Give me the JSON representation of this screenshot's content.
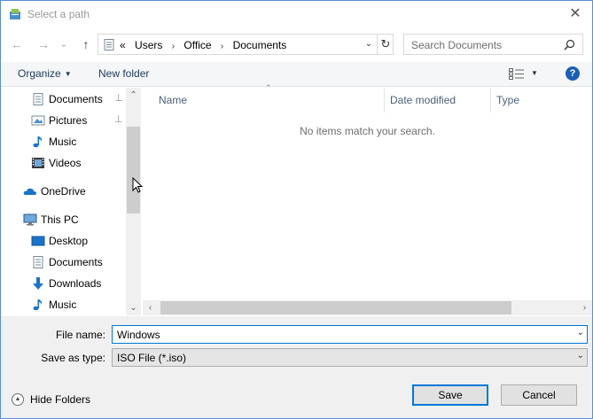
{
  "window": {
    "title": "Select a path",
    "close": "✕"
  },
  "nav": {
    "back": "←",
    "forward": "→",
    "recent": "⌄",
    "up": "↑",
    "crumb_prefix": "«",
    "path": [
      "Users",
      "Office",
      "Documents"
    ],
    "crumb_sep": "›",
    "dropdown": "⌄",
    "refresh": "↻",
    "search_placeholder": "Search Documents"
  },
  "toolbar": {
    "organize": "Organize",
    "new_folder": "New folder",
    "help": "?"
  },
  "sidebar": {
    "items": [
      {
        "label": "Documents",
        "icon": "documents-icon",
        "pinned": true
      },
      {
        "label": "Pictures",
        "icon": "pictures-icon",
        "pinned": true
      },
      {
        "label": "Music",
        "icon": "music-icon",
        "pinned": false
      },
      {
        "label": "Videos",
        "icon": "videos-icon",
        "pinned": false
      },
      {
        "label": "OneDrive",
        "icon": "onedrive-icon",
        "pinned": false
      },
      {
        "label": "This PC",
        "icon": "this-pc-icon",
        "pinned": false
      },
      {
        "label": "Desktop",
        "icon": "desktop-icon",
        "pinned": false
      },
      {
        "label": "Documents",
        "icon": "documents-icon",
        "pinned": false
      },
      {
        "label": "Downloads",
        "icon": "downloads-icon",
        "pinned": false
      },
      {
        "label": "Music",
        "icon": "music-icon",
        "pinned": false
      }
    ],
    "pin_glyph": "📌"
  },
  "columns": {
    "name": "Name",
    "date_modified": "Date modified",
    "type": "Type"
  },
  "content": {
    "empty_message": "No items match your search."
  },
  "form": {
    "file_name_label": "File name:",
    "file_name_value": "Windows",
    "save_as_type_label": "Save as type:",
    "save_as_type_value": "ISO File (*.iso)",
    "dd": "⌄"
  },
  "footer": {
    "hide_folders": "Hide Folders",
    "save": "Save",
    "cancel": "Cancel"
  },
  "colors": {
    "accent": "#0078d7",
    "link": "#1e395b",
    "help": "#1b5fb5",
    "folder_blue": "#1a73c9"
  }
}
